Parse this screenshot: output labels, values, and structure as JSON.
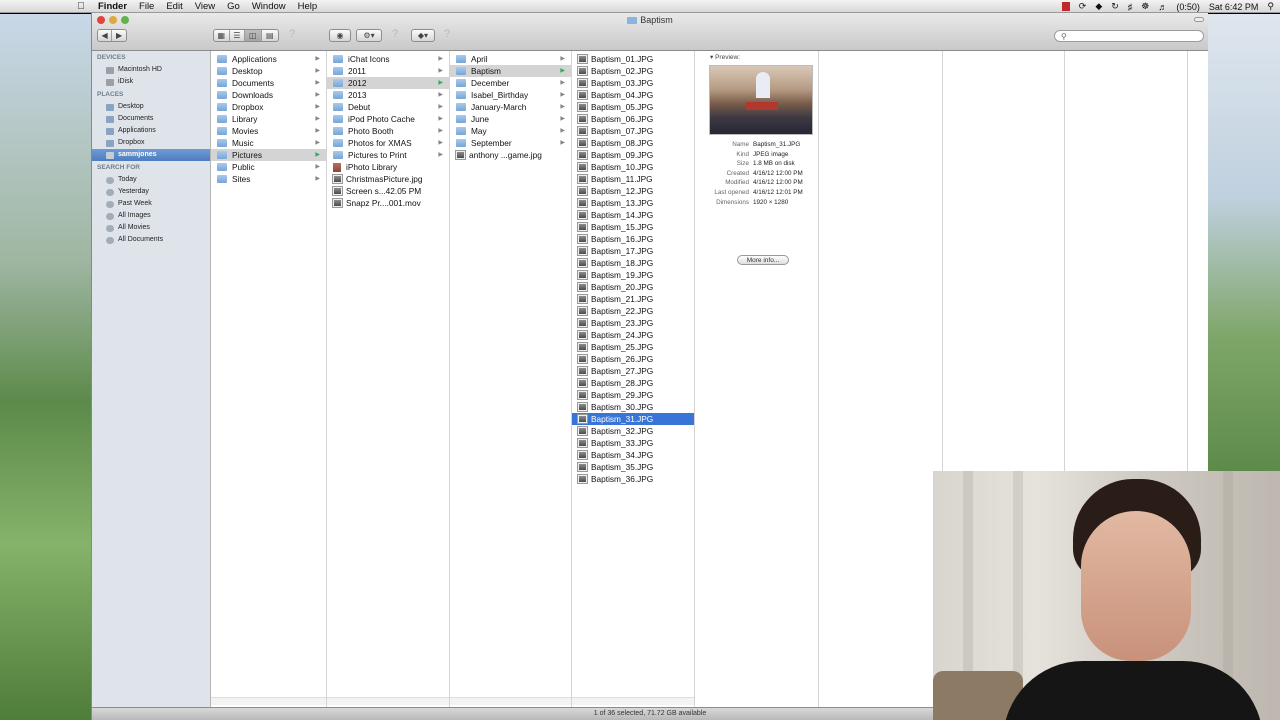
{
  "menubar": {
    "items": [
      "Finder",
      "File",
      "Edit",
      "View",
      "Go",
      "Window",
      "Help"
    ],
    "battery": "(0:50)",
    "clock": "Sat 6:42 PM"
  },
  "window": {
    "title": "Baptism",
    "search_placeholder": ""
  },
  "sidebar": {
    "sections": [
      {
        "header": "DEVICES",
        "items": [
          {
            "label": "Macintosh HD",
            "icon": "drive"
          },
          {
            "label": "iDisk",
            "icon": "drive"
          }
        ]
      },
      {
        "header": "PLACES",
        "items": [
          {
            "label": "Desktop",
            "icon": "folder"
          },
          {
            "label": "Documents",
            "icon": "folder"
          },
          {
            "label": "Applications",
            "icon": "folder"
          },
          {
            "label": "Dropbox",
            "icon": "folder"
          },
          {
            "label": "sammjones",
            "icon": "home",
            "selected": true
          }
        ]
      },
      {
        "header": "SEARCH FOR",
        "items": [
          {
            "label": "Today",
            "icon": "search"
          },
          {
            "label": "Yesterday",
            "icon": "search"
          },
          {
            "label": "Past Week",
            "icon": "search"
          },
          {
            "label": "All Images",
            "icon": "search"
          },
          {
            "label": "All Movies",
            "icon": "search"
          },
          {
            "label": "All Documents",
            "icon": "search"
          }
        ]
      }
    ]
  },
  "columns": [
    {
      "items": [
        {
          "label": "Applications",
          "type": "folder",
          "arrow": true
        },
        {
          "label": "Desktop",
          "type": "folder",
          "arrow": true
        },
        {
          "label": "Documents",
          "type": "folder",
          "arrow": true
        },
        {
          "label": "Downloads",
          "type": "folder",
          "arrow": true
        },
        {
          "label": "Dropbox",
          "type": "folder",
          "arrow": true
        },
        {
          "label": "Library",
          "type": "folder",
          "arrow": true
        },
        {
          "label": "Movies",
          "type": "folder",
          "arrow": true
        },
        {
          "label": "Music",
          "type": "folder",
          "arrow": true
        },
        {
          "label": "Pictures",
          "type": "folder",
          "arrow": true,
          "selected": "gray"
        },
        {
          "label": "Public",
          "type": "folder",
          "arrow": true
        },
        {
          "label": "Sites",
          "type": "folder",
          "arrow": true
        }
      ]
    },
    {
      "items": [
        {
          "label": "iChat Icons",
          "type": "folder",
          "arrow": true
        },
        {
          "label": "2011",
          "type": "folder",
          "arrow": true
        },
        {
          "label": "2012",
          "type": "folder",
          "arrow": true,
          "selected": "gray"
        },
        {
          "label": "2013",
          "type": "folder",
          "arrow": true
        },
        {
          "label": "Debut",
          "type": "folder",
          "arrow": true
        },
        {
          "label": "iPod Photo Cache",
          "type": "folder",
          "arrow": true
        },
        {
          "label": "Photo Booth",
          "type": "folder",
          "arrow": true
        },
        {
          "label": "Photos for XMAS",
          "type": "folder",
          "arrow": true
        },
        {
          "label": "Pictures to Print",
          "type": "folder",
          "arrow": true
        },
        {
          "label": "iPhoto Library",
          "type": "doc",
          "arrow": false
        },
        {
          "label": "ChristmasPicture.jpg",
          "type": "image",
          "arrow": false
        },
        {
          "label": "Screen s...42.05 PM",
          "type": "image",
          "arrow": false
        },
        {
          "label": "Snapz Pr....001.mov",
          "type": "image",
          "arrow": false
        }
      ]
    },
    {
      "items": [
        {
          "label": "April",
          "type": "folder",
          "arrow": true
        },
        {
          "label": "Baptism",
          "type": "folder",
          "arrow": true,
          "selected": "gray"
        },
        {
          "label": "December",
          "type": "folder",
          "arrow": true
        },
        {
          "label": "Isabel_Birthday",
          "type": "folder",
          "arrow": true
        },
        {
          "label": "January-March",
          "type": "folder",
          "arrow": true
        },
        {
          "label": "June",
          "type": "folder",
          "arrow": true
        },
        {
          "label": "May",
          "type": "folder",
          "arrow": true
        },
        {
          "label": "September",
          "type": "folder",
          "arrow": true
        },
        {
          "label": "anthony ...game.jpg",
          "type": "image",
          "arrow": false
        }
      ]
    },
    {
      "items": [
        {
          "label": "Baptism_01.JPG"
        },
        {
          "label": "Baptism_02.JPG"
        },
        {
          "label": "Baptism_03.JPG"
        },
        {
          "label": "Baptism_04.JPG"
        },
        {
          "label": "Baptism_05.JPG"
        },
        {
          "label": "Baptism_06.JPG"
        },
        {
          "label": "Baptism_07.JPG"
        },
        {
          "label": "Baptism_08.JPG"
        },
        {
          "label": "Baptism_09.JPG"
        },
        {
          "label": "Baptism_10.JPG"
        },
        {
          "label": "Baptism_11.JPG"
        },
        {
          "label": "Baptism_12.JPG"
        },
        {
          "label": "Baptism_13.JPG"
        },
        {
          "label": "Baptism_14.JPG"
        },
        {
          "label": "Baptism_15.JPG"
        },
        {
          "label": "Baptism_16.JPG"
        },
        {
          "label": "Baptism_17.JPG"
        },
        {
          "label": "Baptism_18.JPG"
        },
        {
          "label": "Baptism_19.JPG"
        },
        {
          "label": "Baptism_20.JPG"
        },
        {
          "label": "Baptism_21.JPG"
        },
        {
          "label": "Baptism_22.JPG"
        },
        {
          "label": "Baptism_23.JPG"
        },
        {
          "label": "Baptism_24.JPG"
        },
        {
          "label": "Baptism_25.JPG"
        },
        {
          "label": "Baptism_26.JPG"
        },
        {
          "label": "Baptism_27.JPG"
        },
        {
          "label": "Baptism_28.JPG"
        },
        {
          "label": "Baptism_29.JPG"
        },
        {
          "label": "Baptism_30.JPG"
        },
        {
          "label": "Baptism_31.JPG",
          "selected": "blue"
        },
        {
          "label": "Baptism_32.JPG"
        },
        {
          "label": "Baptism_33.JPG"
        },
        {
          "label": "Baptism_34.JPG"
        },
        {
          "label": "Baptism_35.JPG"
        },
        {
          "label": "Baptism_36.JPG"
        }
      ]
    }
  ],
  "preview": {
    "header": "Preview:",
    "meta": [
      {
        "key": "Name",
        "value": "Baptism_31.JPG"
      },
      {
        "key": "Kind",
        "value": "JPEG image"
      },
      {
        "key": "Size",
        "value": "1.8 MB on disk"
      },
      {
        "key": "Created",
        "value": "4/16/12 12:00 PM"
      },
      {
        "key": "Modified",
        "value": "4/16/12 12:00 PM"
      },
      {
        "key": "Last opened",
        "value": "4/16/12 12:01 PM"
      },
      {
        "key": "Dimensions",
        "value": "1920 × 1280"
      }
    ],
    "more_info": "More info..."
  },
  "statusbar": {
    "text": "1 of 36 selected, 71.72 GB available"
  },
  "colors": {
    "selection_blue": "#3875d7",
    "selection_gray": "#d4d4d4",
    "sidebar_bg": "#dfe4ea"
  }
}
